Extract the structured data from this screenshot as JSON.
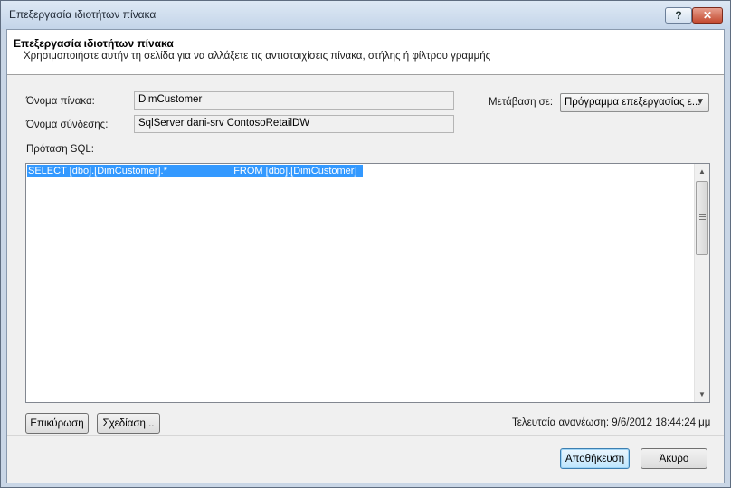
{
  "window": {
    "title": "Επεξεργασία ιδιοτήτων πίνακα",
    "help_label": "?",
    "close_label": "✕"
  },
  "header": {
    "title": "Επεξεργασία ιδιοτήτων πίνακα",
    "description": "Χρησιμοποιήστε αυτήν τη σελίδα για να αλλάξετε τις αντιστοιχίσεις πίνακα, στήλης ή φίλτρου γραμμής"
  },
  "form": {
    "table_name_label": "Όνομα πίνακα:",
    "table_name_value": "DimCustomer",
    "connection_name_label": "Όνομα σύνδεσης:",
    "connection_name_value": "SqlServer dani-srv ContosoRetailDW",
    "switch_to_label": "Μετάβαση σε:",
    "switch_to_value": "Πρόγραμμα επεξεργασίας ε...",
    "sql_label": "Πρόταση SQL:",
    "sql_text": "SELECT [dbo].[DimCustomer].*                        FROM [dbo].[DimCustomer]"
  },
  "actions": {
    "validate_label": "Επικύρωση",
    "design_label": "Σχεδίαση...",
    "last_refresh": "Τελευταία ανανέωση: 9/6/2012 18:44:24 μμ",
    "save_label": "Αποθήκευση",
    "cancel_label": "Άκυρο"
  }
}
